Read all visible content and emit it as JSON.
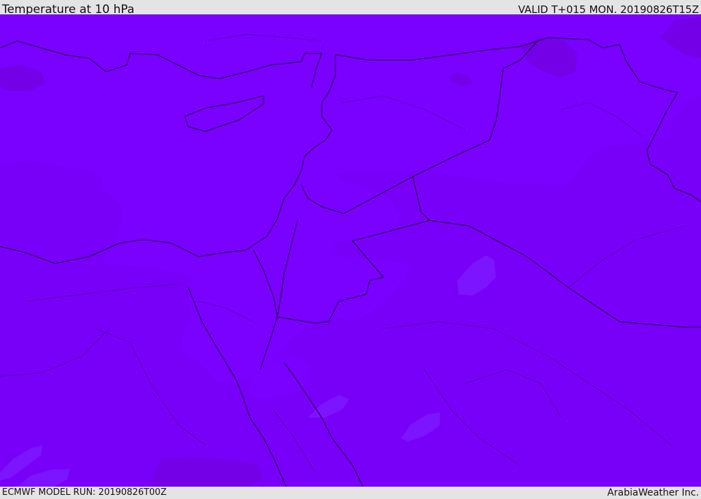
{
  "header": {
    "title": "Temperature at 10 hPa",
    "valid": "VALID T+015 MON. 20190826T15Z"
  },
  "footer": {
    "model_run": "ECMWF MODEL RUN: 20190826T00Z",
    "credit": "ArabiaWeather Inc."
  },
  "map": {
    "colors": {
      "field_warm": "#7800f8",
      "field_cool": "#7a00ff",
      "field_cooler": "#7d14ff",
      "field_warm_spot": "#7300e6",
      "border": "#1a0033"
    }
  }
}
